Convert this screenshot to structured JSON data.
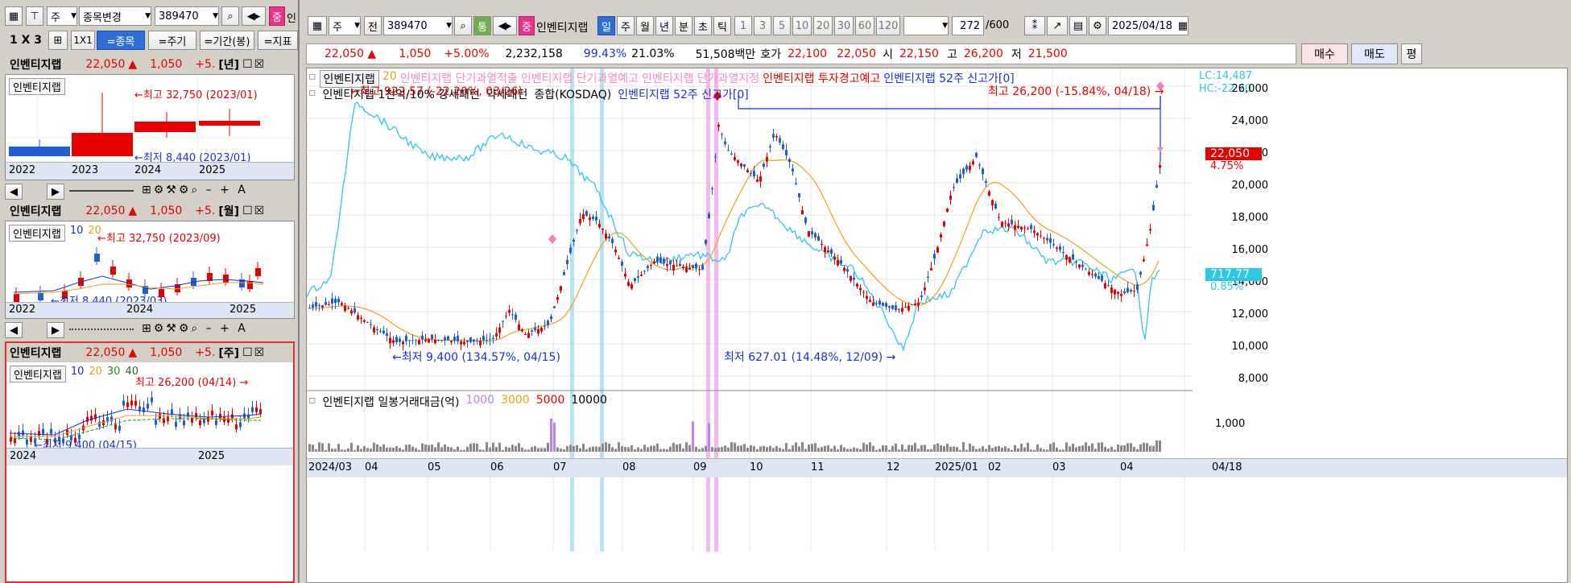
{
  "left_toolbar": {
    "period_select": "주",
    "stock_change_label": "종목변경",
    "code_value": "389470",
    "badge": "중",
    "badge_name": "인",
    "layout_label": "1 X 3",
    "one_by_one": "1X1",
    "tabs": [
      "=종목",
      "=주기",
      "=기간(봉)",
      "=지표"
    ]
  },
  "mini_charts": [
    {
      "name": "인벤티지랩",
      "price": "22,050",
      "change_arrow": "▲",
      "change": "1,050",
      "pct": "+5.",
      "period": "[년]",
      "legend": "인벤티지랩",
      "ma_labels": [],
      "high_label": "←최고 32,750 (2023/01)",
      "low_label": "←최저 8,440 (2023/01)",
      "x_labels": [
        "2022",
        "2023",
        "2024",
        "2025"
      ]
    },
    {
      "name": "인벤티지랩",
      "price": "22,050",
      "change_arrow": "▲",
      "change": "1,050",
      "pct": "+5.",
      "period": "[월]",
      "legend": "인벤티지랩",
      "ma_labels": [
        "10",
        "20"
      ],
      "high_label": "←최고 32,750 (2023/09)",
      "low_label": "←최저 8,440 (2023/03)",
      "x_labels": [
        "2022",
        "2024",
        "2025"
      ]
    },
    {
      "name": "인벤티지랩",
      "price": "22,050",
      "change_arrow": "▲",
      "change": "1,050",
      "pct": "+5.",
      "period": "[주]",
      "legend": "인벤티지랩",
      "ma_labels": [
        "10",
        "20",
        "30",
        "40"
      ],
      "high_label": "최고 26,200 (04/14) →",
      "low_label": "←최저 9,400 (04/15)",
      "x_labels": [
        "2024",
        "2025"
      ]
    }
  ],
  "main_toolbar": {
    "period": "주",
    "prev_label": "전",
    "code": "389470",
    "comm_label": "통",
    "badge": "중",
    "stock_name": "인벤티지랩",
    "period_buttons": [
      "일",
      "주",
      "월",
      "년",
      "분",
      "초",
      "틱"
    ],
    "active_period": "일",
    "interval_buttons": [
      "1",
      "3",
      "5",
      "10",
      "20",
      "30",
      "60",
      "120"
    ],
    "count": "272",
    "total": "/600",
    "date": "2025/04/18"
  },
  "quote_bar": {
    "price": "22,050 ▲",
    "change": "1,050",
    "pct": "+5.00%",
    "volume": "2,232,158",
    "vol_ratio": "99.43%",
    "turnover": "21.03%",
    "amount": "51,508백만",
    "bid_label": "호가",
    "bid1": "22,100",
    "bid2": "22,050",
    "open_label": "시",
    "open": "22,150",
    "high_label": "고",
    "high": "26,200",
    "low_label": "저",
    "low": "21,500",
    "buy": "매수",
    "sell": "매도",
    "avg": "평"
  },
  "main_chart": {
    "legend_line1": [
      {
        "text": "인벤티지랩",
        "color": "#000000"
      },
      {
        "text": "20",
        "color": "#e8a317"
      },
      {
        "text": "인벤티지랩 단기과열적출",
        "color": "#f08cc8"
      },
      {
        "text": "인벤티지랩 단기과열예고",
        "color": "#f08cc8"
      },
      {
        "text": "인벤티지랩 단기과열지정",
        "color": "#f08cc8"
      },
      {
        "text": "인벤티지랩 투자경고예고",
        "color": "#e60000"
      },
      {
        "text": "인벤티지랩 52주 신고가[0]",
        "color": "#1a2fd6"
      }
    ],
    "legend_line2": [
      {
        "text": "인벤티지랩 1천억/10% 강세패턴",
        "color": "#000000"
      },
      {
        "text": "약세패턴",
        "color": "#000000"
      },
      {
        "text": "종합(KOSDAQ)",
        "color": "#000000"
      },
      {
        "text": "인벤티지랩 52주 신고가[0]",
        "color": "#1a2fd6"
      }
    ],
    "lc_label": "LC:14,487",
    "hc_label": "HC:-22.20",
    "annotations": {
      "kosdaq_high": "←최고 922.57 (-22.20%, 03/26)",
      "price_high": "최고 26,200 (-15.84%, 04/18) →",
      "price_low": "←최저 9,400 (134.57%, 04/15)",
      "kosdaq_low": "최저 627.01 (14.48%, 12/09) →"
    },
    "y_ticks": [
      "26,000",
      "24,000",
      "22,000",
      "20,000",
      "18,000",
      "16,000",
      "14,000",
      "12,000",
      "10,000",
      "8,000"
    ],
    "price_tag": "22,050",
    "price_tag_pct": "4.75%",
    "kosdaq_tag": "717.77",
    "kosdaq_tag_pct": "0.85%",
    "volume_legend": [
      {
        "text": "인벤티지랩 일봉거래대금(억)",
        "color": "#000000"
      },
      {
        "text": "1000",
        "color": "#c080f0"
      },
      {
        "text": "3000",
        "color": "#e8a317"
      },
      {
        "text": "5000",
        "color": "#e60000"
      },
      {
        "text": "10000",
        "color": "#000000"
      }
    ],
    "volume_tick": "1,000",
    "x_labels": [
      "2024/03",
      "04",
      "05",
      "06",
      "07",
      "08",
      "09",
      "10",
      "11",
      "12",
      "2025/01",
      "02",
      "03",
      "04"
    ],
    "right_date": "04/18"
  },
  "chart_data": {
    "type": "line",
    "series": [
      {
        "name": "인벤티지랩",
        "y_range": [
          9400,
          26200
        ],
        "last": 22050
      },
      {
        "name": "종합(KOSDAQ)",
        "y_range": [
          627.01,
          922.57
        ],
        "last": 717.77
      }
    ],
    "ylim": [
      7000,
      27000
    ]
  }
}
